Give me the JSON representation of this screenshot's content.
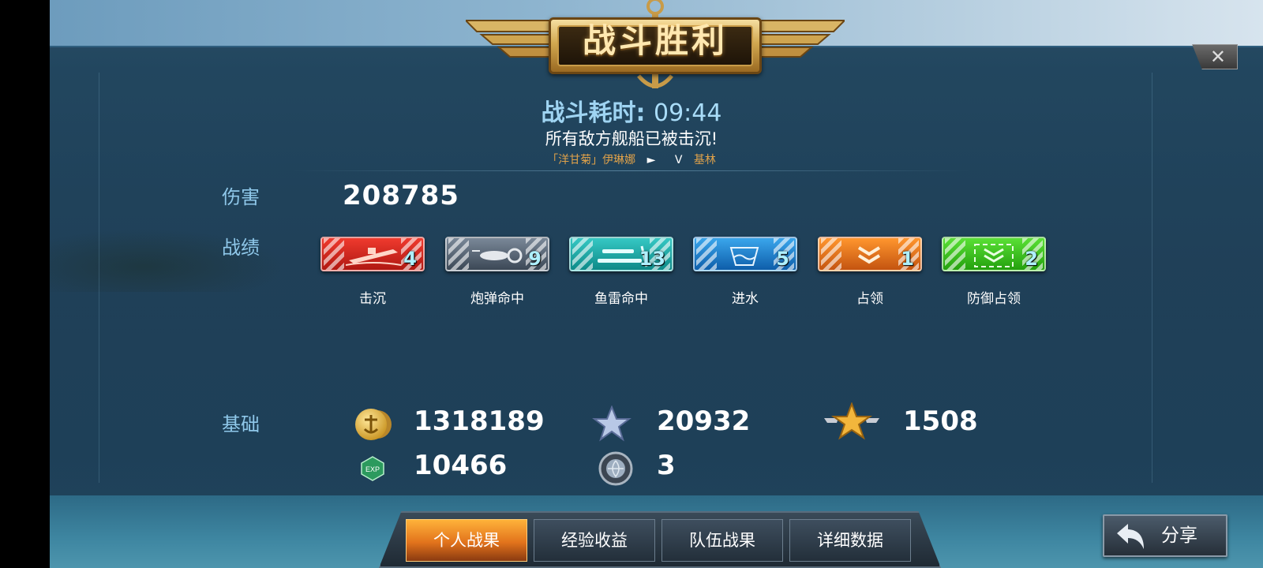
{
  "banner": {
    "title": "战斗胜利"
  },
  "header": {
    "time_label": "战斗耗时:",
    "time_value": "09:44",
    "result_text": "所有敌方舰船已被击沉!",
    "player_left": "「洋甘菊」伊琳娜",
    "player_arrow": "►",
    "player_sep": "V",
    "player_right": "基林"
  },
  "damage": {
    "label": "伤害",
    "value": "208785"
  },
  "record": {
    "label": "战绩",
    "badges": [
      {
        "count": "4",
        "caption": "击沉",
        "color": "#d8281e",
        "icon": "sunk-ship-icon"
      },
      {
        "count": "9",
        "caption": "炮弹命中",
        "color": "#5a6878",
        "icon": "shell-hit-icon"
      },
      {
        "count": "13",
        "caption": "鱼雷命中",
        "color": "#1ea6a6",
        "icon": "torpedo-icon"
      },
      {
        "count": "5",
        "caption": "进水",
        "color": "#1e84d6",
        "icon": "flooding-icon"
      },
      {
        "count": "1",
        "caption": "占领",
        "color": "#e4741c",
        "icon": "capture-icon"
      },
      {
        "count": "2",
        "caption": "防御占领",
        "color": "#38c820",
        "icon": "defend-capture-icon"
      }
    ]
  },
  "base": {
    "label": "基础",
    "silver": "1318189",
    "free_xp": "20932",
    "rank_points": "1508",
    "exp": "10466",
    "globe": "3"
  },
  "tabs": [
    {
      "label": "个人战果",
      "active": true
    },
    {
      "label": "经验收益",
      "active": false
    },
    {
      "label": "队伍战果",
      "active": false
    },
    {
      "label": "详细数据",
      "active": false
    }
  ],
  "share": {
    "label": "分享"
  },
  "close": {
    "glyph": "✕"
  }
}
